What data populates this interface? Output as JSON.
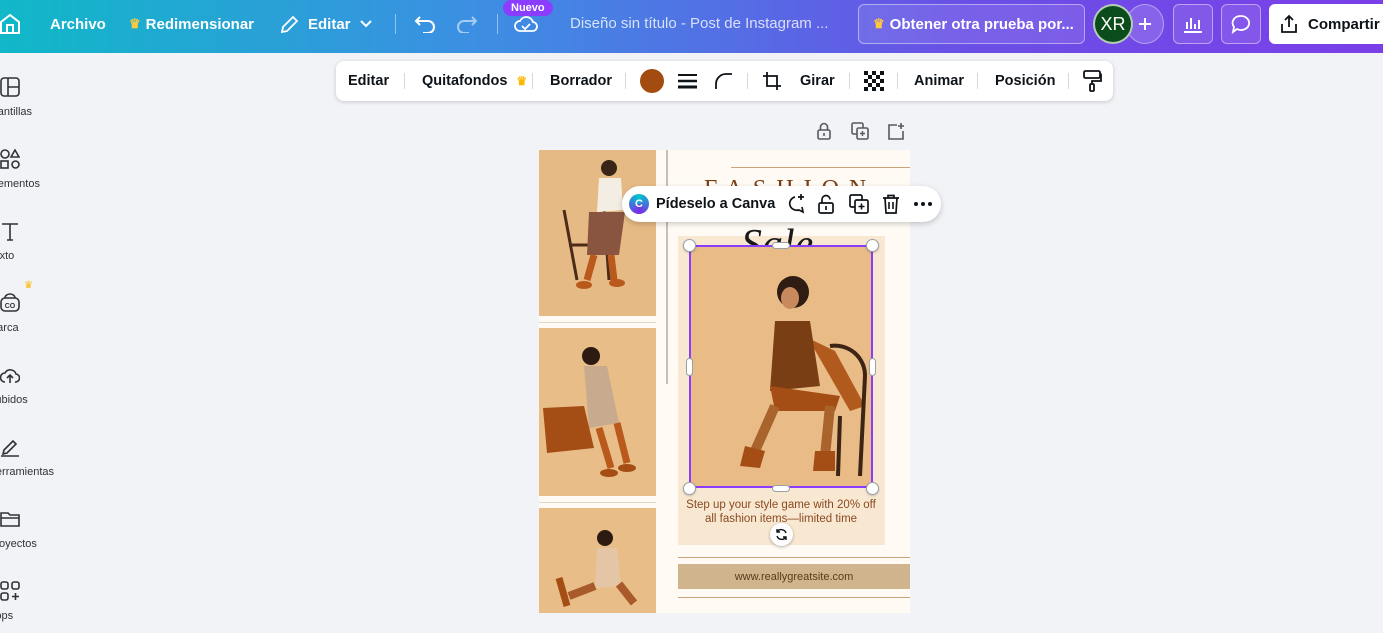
{
  "topbar": {
    "archivo": "Archivo",
    "redimensionar": "Redimensionar",
    "editar": "Editar",
    "nuevo_badge": "Nuevo",
    "doc_title": "Diseño sin título - Post de Instagram ...",
    "trial_button": "Obtener otra prueba por...",
    "avatar_initials": "XR",
    "share_button": "Compartir"
  },
  "sidebar": {
    "items": [
      {
        "label": "Plantillas",
        "icon": "template-icon"
      },
      {
        "label": "Elementos",
        "icon": "shapes-icon"
      },
      {
        "label": "Texto",
        "icon": "text-icon"
      },
      {
        "label": "Marca",
        "icon": "brand-icon"
      },
      {
        "label": "Subidos",
        "icon": "cloud-upload-icon"
      },
      {
        "label": "Herramientas",
        "icon": "pen-icon"
      },
      {
        "label": "Proyectos",
        "icon": "folder-icon"
      },
      {
        "label": "Apps",
        "icon": "apps-icon"
      }
    ]
  },
  "context_toolbar": {
    "editar": "Editar",
    "quitafondos": "Quitafondos",
    "borrador": "Borrador",
    "color": "#a24d0f",
    "girar": "Girar",
    "animar": "Animar",
    "posicion": "Posición"
  },
  "floating_bar": {
    "label": "Pídeselo a Canva"
  },
  "design": {
    "heading": "FASHION",
    "script_word": "Sale",
    "promo": "Step up your style game with 20% off all fashion items—limited time",
    "website": "www.reallygreatsite.com"
  },
  "colors": {
    "accent": "#8b3dff",
    "brand_brown": "#7a3e15"
  }
}
